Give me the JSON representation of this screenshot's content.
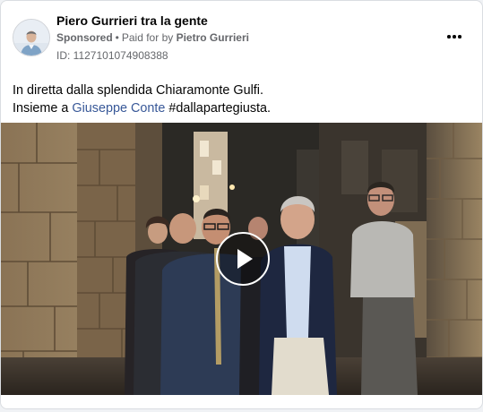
{
  "post": {
    "page_name": "Piero Gurrieri tra la gente",
    "sponsored_label": "Sponsored",
    "separator": "•",
    "paid_for_prefix": "Paid for by",
    "payer": "Pietro Gurrieri",
    "ad_id": "ID: 1127101074908388",
    "text_line1": "In diretta dalla splendida Chiaramonte Gulfi.",
    "text_line2_prefix": "Insieme a ",
    "mention": "Giuseppe Conte",
    "hashtag": "#dallapartegiusta."
  },
  "media": {
    "type": "video",
    "play_icon": "play-icon"
  },
  "icons": {
    "more": "more-options-icon",
    "avatar": "profile-avatar"
  },
  "colors": {
    "link": "#385898",
    "secondary_text": "#65676b"
  }
}
